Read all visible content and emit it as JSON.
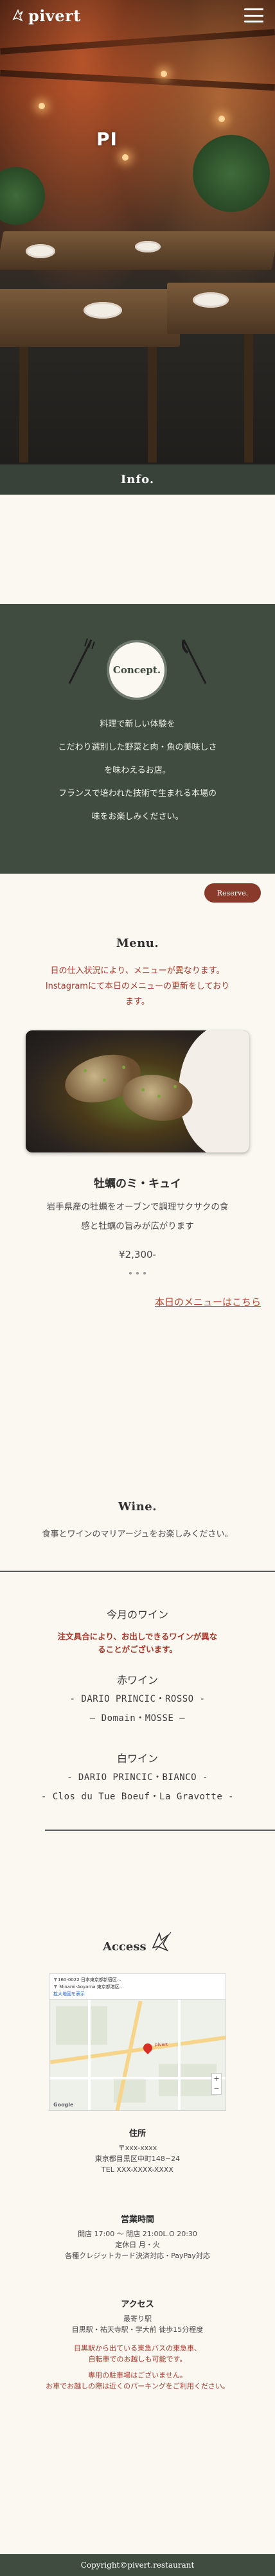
{
  "header": {
    "brand": "pivert",
    "menu_icon": "hamburger-icon"
  },
  "hero": {
    "sign": "PI",
    "info_label": "Info."
  },
  "concept": {
    "badge": "Concept.",
    "lines": [
      "料理で新しい体験を",
      "こだわり選別した野菜と肉・魚の美味しさ",
      "を味わえるお店。",
      "フランスで培われた技術で生まれる本場の",
      "味をお楽しみください。"
    ]
  },
  "reserve": {
    "label": "Reserve."
  },
  "menu": {
    "title": "Menu.",
    "note": [
      "日の仕入状況により、メニューが異なります。",
      "Instagramにて本日のメニューの更新をしており",
      "ます。"
    ],
    "dish": {
      "name": "牡蠣のミ・キュイ",
      "desc": [
        "岩手県産の牡蠣をオーブンで調理サクサクの食",
        "感と牡蠣の旨みが広がります"
      ],
      "price": "¥2,300-"
    },
    "today_link": "本日のメニューはこちら"
  },
  "wine": {
    "title": "Wine.",
    "subtitle": "食事とワインのマリアージュをお楽しみください。",
    "box_title": "今月のワイン",
    "note": [
      "注文具合により、お出しできるワインが異な",
      "ることがございます。"
    ],
    "red": {
      "label": "赤ワイン",
      "lines": [
        "- DARIO PRINCIC・ROSSO -",
        "– Domain・MOSSE –"
      ]
    },
    "white": {
      "label": "白ワイン",
      "lines": [
        "- DARIO PRINCIC・BIANCO -",
        "- Clos du Tue Boeuf・La Gravotte -"
      ]
    }
  },
  "access": {
    "title": "Access",
    "map": {
      "address_line1": "〒160-0022 日本東京都新宿区...",
      "address_line2": "〒 Minami-Aoyama 東京都港区...",
      "link": "拡大地図を表示",
      "google": "Google",
      "label": "pivert"
    },
    "address": {
      "heading": "住所",
      "lines": [
        "〒xxx-xxxx",
        "東京都目黒区中町148−24",
        "TEL   XXX-XXXX-XXXX"
      ]
    },
    "hours": {
      "heading": "営業時間",
      "lines": [
        "開店 17:00 〜 閉店 21:00L.O 20:30",
        "定休日 月・火",
        "各種クレジットカード決済対応・PayPay対応"
      ]
    },
    "directions": {
      "heading": "アクセス",
      "lines": [
        "最寄り駅",
        "目黒駅・祐天寺駅・学大前 徒歩15分程度"
      ],
      "notes": [
        "目黒駅から出ている東急バスの東急車、",
        "自転車でのお越しも可能です。",
        "専用の駐車場はございません。",
        "お車でお越しの際は近くのパーキングをご利用ください。"
      ]
    }
  },
  "footer": {
    "copyright": "Copyright©pivert.restaurant"
  },
  "colors": {
    "accent_green": "#414c40",
    "accent_red": "#a8392a",
    "reserve_bg": "#8a3a2a",
    "background": "#fbf8f2"
  }
}
